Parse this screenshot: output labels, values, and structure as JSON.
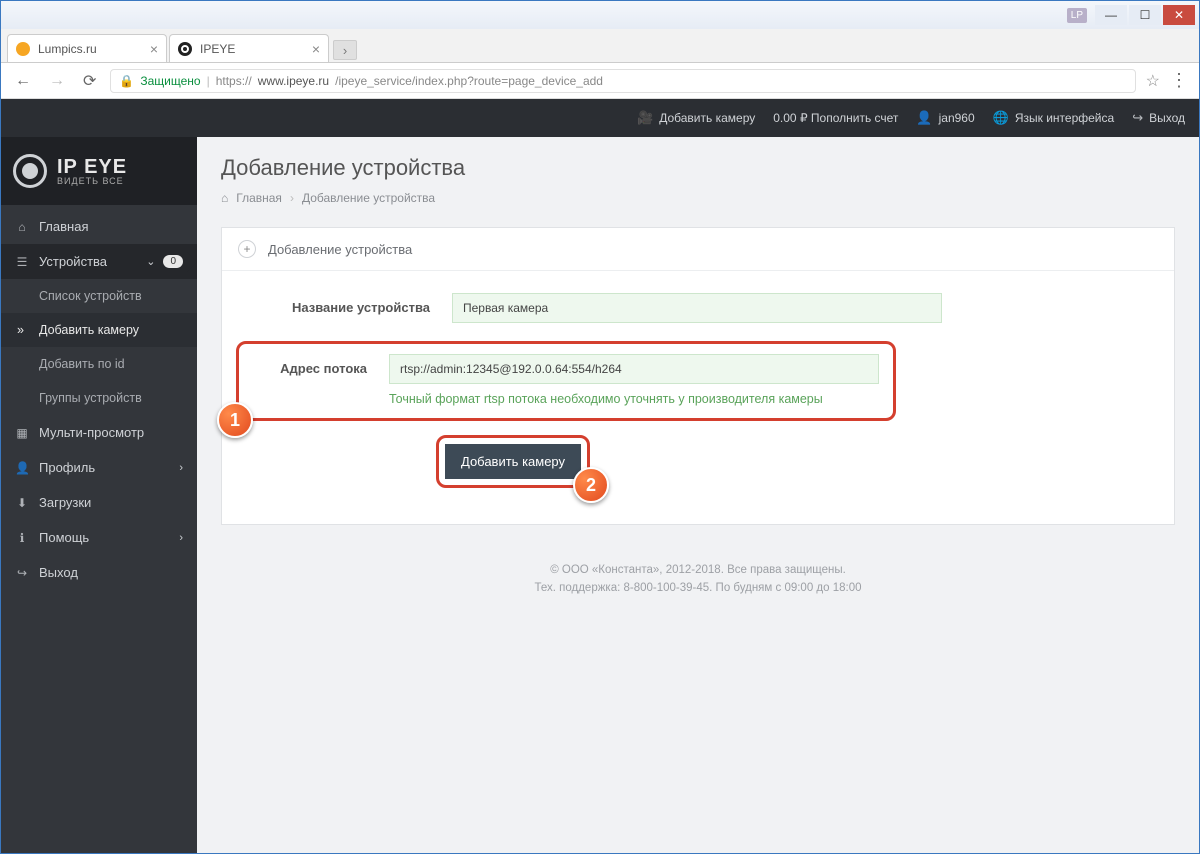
{
  "window": {
    "badge": "LP"
  },
  "tabs": [
    {
      "title": "Lumpics.ru",
      "favicon": "fav-orange"
    },
    {
      "title": "IPEYE",
      "favicon": "fav-eye"
    }
  ],
  "addressbar": {
    "secure_label": "Защищено",
    "proto": "https://",
    "host": "www.ipeye.ru",
    "path": "/ipeye_service/index.php?route=page_device_add"
  },
  "topbar": {
    "add_camera": "Добавить камеру",
    "balance": "0.00 ₽ Пополнить счет",
    "user": "jan960",
    "lang": "Язык интерфейса",
    "logout": "Выход"
  },
  "logo": {
    "line1": "IP EYE",
    "line2": "ВИДЕТЬ ВСЕ"
  },
  "sidebar": {
    "home": "Главная",
    "devices": "Устройства",
    "devices_badge": "0",
    "devices_list": "Список устройств",
    "add_camera": "Добавить камеру",
    "add_by_id": "Добавить по id",
    "device_groups": "Группы устройств",
    "multiview": "Мульти-просмотр",
    "profile": "Профиль",
    "downloads": "Загрузки",
    "help": "Помощь",
    "logout": "Выход"
  },
  "page": {
    "title": "Добавление устройства",
    "crumb_home": "Главная",
    "crumb_current": "Добавление устройства"
  },
  "panel": {
    "heading": "Добавление устройства",
    "name_label": "Название устройства",
    "name_value": "Первая камера",
    "stream_label": "Адрес потока",
    "stream_value": "rtsp://admin:12345@192.0.0.64:554/h264",
    "stream_help": "Точный формат rtsp потока необходимо уточнять у производителя камеры",
    "submit": "Добавить камеру"
  },
  "callouts": {
    "one": "1",
    "two": "2"
  },
  "footer": {
    "line1": "© ООО «Константа», 2012-2018. Все права защищены.",
    "line2": "Тех. поддержка: 8-800-100-39-45. По будням с 09:00 до 18:00"
  }
}
